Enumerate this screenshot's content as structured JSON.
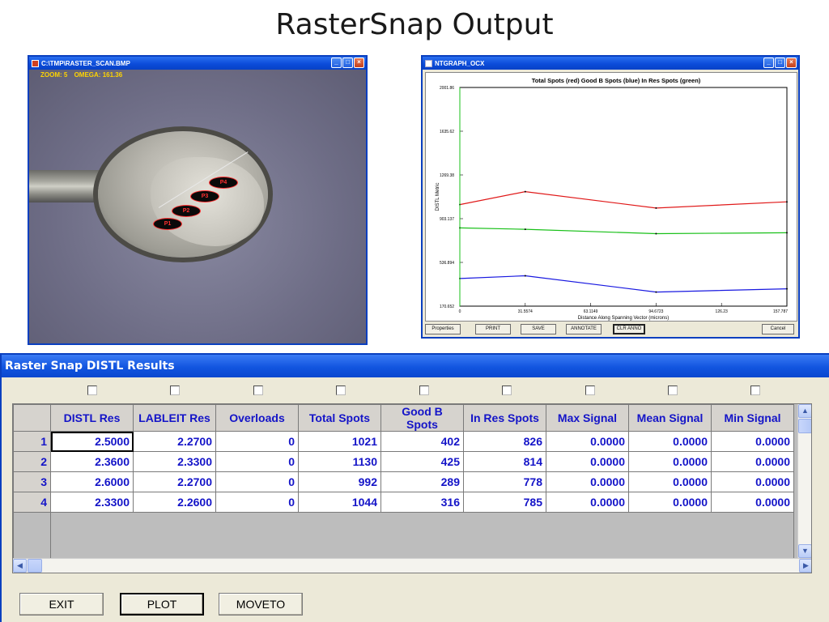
{
  "slide": {
    "title": "RasterSnap Output"
  },
  "raster_window": {
    "title": "C:\\TMP\\RASTER_SCAN.BMP",
    "zoom_label": "ZOOM: 5",
    "omega_label": "OMEGA: 161.36",
    "points": [
      "P1",
      "P2",
      "P3",
      "P4"
    ]
  },
  "graph_window": {
    "title": "NTGRAPH_OCX",
    "buttons": [
      "Properties",
      "PRINT",
      "SAVE",
      "ANNOTATE",
      "CLR ANNO",
      "Cancel"
    ]
  },
  "chart_data": {
    "type": "line",
    "title": "Total Spots (red)   Good B Spots (blue)   In Res Spots (green)",
    "xlabel": "Distance Along Spanning Vector (microns)",
    "ylabel": "DISTL Metric",
    "x_ticks": [
      "0",
      "31.5574",
      "63.1149",
      "94.6723",
      "126.23",
      "157.787"
    ],
    "y_ticks": [
      "170.652",
      "536.894",
      "903.137",
      "1269.38",
      "1635.62",
      "2001.86"
    ],
    "xlim": [
      0,
      157.787
    ],
    "ylim": [
      170.652,
      2001.86
    ],
    "x": [
      0,
      31.5574,
      94.6723,
      157.787
    ],
    "series": [
      {
        "name": "Total Spots",
        "color": "#e01818",
        "values": [
          1021,
          1130,
          992,
          1044
        ]
      },
      {
        "name": "In Res Spots",
        "color": "#18c018",
        "values": [
          826,
          814,
          778,
          785
        ]
      },
      {
        "name": "Good B Spots",
        "color": "#1818e0",
        "values": [
          402,
          425,
          289,
          316
        ]
      }
    ]
  },
  "distl_window": {
    "title": "Raster Snap DISTL Results",
    "columns": [
      "DISTL Res",
      "LABLEIT Res",
      "Overloads",
      "Total Spots",
      "Good B Spots",
      "In Res Spots",
      "Max Signal",
      "Mean Signal",
      "Min Signal"
    ],
    "rows": [
      {
        "index": "1",
        "cells": [
          "2.5000",
          "2.2700",
          "0",
          "1021",
          "402",
          "826",
          "0.0000",
          "0.0000",
          "0.0000"
        ]
      },
      {
        "index": "2",
        "cells": [
          "2.3600",
          "2.3300",
          "0",
          "1130",
          "425",
          "814",
          "0.0000",
          "0.0000",
          "0.0000"
        ]
      },
      {
        "index": "3",
        "cells": [
          "2.6000",
          "2.2700",
          "0",
          "992",
          "289",
          "778",
          "0.0000",
          "0.0000",
          "0.0000"
        ]
      },
      {
        "index": "4",
        "cells": [
          "2.3300",
          "2.2600",
          "0",
          "1044",
          "316",
          "785",
          "0.0000",
          "0.0000",
          "0.0000"
        ]
      }
    ],
    "buttons": {
      "exit": "EXIT",
      "plot": "PLOT",
      "moveto": "MOVETO"
    }
  }
}
